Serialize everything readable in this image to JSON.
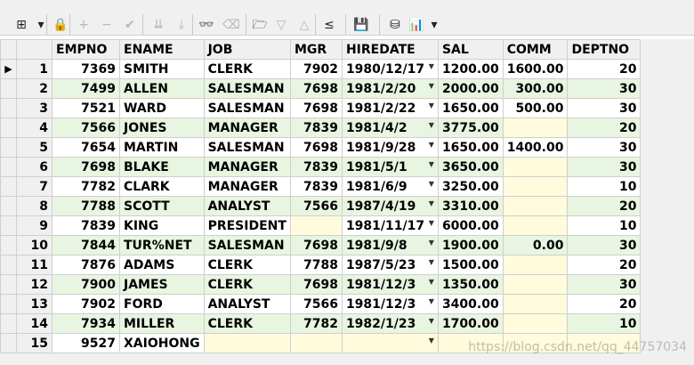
{
  "toolbar": {
    "buttons": [
      {
        "name": "grid-layout-icon",
        "glyph": "⊞",
        "disabled": false
      },
      {
        "name": "dropdown-arrow-icon",
        "glyph": "▾",
        "disabled": false
      },
      {
        "name": "lock-icon",
        "glyph": "🔒",
        "disabled": false
      },
      {
        "name": "insert-record-icon",
        "glyph": "+",
        "disabled": true
      },
      {
        "name": "delete-record-icon",
        "glyph": "−",
        "disabled": true
      },
      {
        "name": "post-changes-icon",
        "glyph": "✔",
        "disabled": true
      },
      {
        "name": "next-records-icon",
        "glyph": "⇊",
        "disabled": true
      },
      {
        "name": "last-records-icon",
        "glyph": "⤓",
        "disabled": true
      },
      {
        "name": "find-binoculars-icon",
        "glyph": "👓",
        "disabled": false
      },
      {
        "name": "clear-filter-icon",
        "glyph": "⌫",
        "disabled": true
      },
      {
        "name": "query-by-example-icon",
        "glyph": "🗁",
        "disabled": false
      },
      {
        "name": "filter-down-icon",
        "glyph": "▽",
        "disabled": true
      },
      {
        "name": "filter-up-icon",
        "glyph": "△",
        "disabled": true
      },
      {
        "name": "connect-icon",
        "glyph": "≤",
        "disabled": false
      },
      {
        "name": "save-icon",
        "glyph": "💾",
        "disabled": false
      },
      {
        "name": "export-icon",
        "glyph": "⛁",
        "disabled": false
      },
      {
        "name": "chart-icon",
        "glyph": "📊",
        "disabled": false
      },
      {
        "name": "chart-dropdown-icon",
        "glyph": "▾",
        "disabled": false
      }
    ]
  },
  "grid": {
    "columns": [
      "EMPNO",
      "ENAME",
      "JOB",
      "MGR",
      "HIREDATE",
      "SAL",
      "COMM",
      "DEPTNO"
    ],
    "current_row_indicator": "▶",
    "rows": [
      {
        "n": "1",
        "empno": "7369",
        "ename": "SMITH",
        "job": "CLERK",
        "mgr": "7902",
        "hiredate": "1980/12/17",
        "sal": "1200.00",
        "comm": "1600.00",
        "deptno": "20"
      },
      {
        "n": "2",
        "empno": "7499",
        "ename": "ALLEN",
        "job": "SALESMAN",
        "mgr": "7698",
        "hiredate": "1981/2/20",
        "sal": "2000.00",
        "comm": "300.00",
        "deptno": "30"
      },
      {
        "n": "3",
        "empno": "7521",
        "ename": "WARD",
        "job": "SALESMAN",
        "mgr": "7698",
        "hiredate": "1981/2/22",
        "sal": "1650.00",
        "comm": "500.00",
        "deptno": "30"
      },
      {
        "n": "4",
        "empno": "7566",
        "ename": "JONES",
        "job": "MANAGER",
        "mgr": "7839",
        "hiredate": "1981/4/2",
        "sal": "3775.00",
        "comm": "",
        "deptno": "20"
      },
      {
        "n": "5",
        "empno": "7654",
        "ename": "MARTIN",
        "job": "SALESMAN",
        "mgr": "7698",
        "hiredate": "1981/9/28",
        "sal": "1650.00",
        "comm": "1400.00",
        "deptno": "30"
      },
      {
        "n": "6",
        "empno": "7698",
        "ename": "BLAKE",
        "job": "MANAGER",
        "mgr": "7839",
        "hiredate": "1981/5/1",
        "sal": "3650.00",
        "comm": "",
        "deptno": "30"
      },
      {
        "n": "7",
        "empno": "7782",
        "ename": "CLARK",
        "job": "MANAGER",
        "mgr": "7839",
        "hiredate": "1981/6/9",
        "sal": "3250.00",
        "comm": "",
        "deptno": "10"
      },
      {
        "n": "8",
        "empno": "7788",
        "ename": "SCOTT",
        "job": "ANALYST",
        "mgr": "7566",
        "hiredate": "1987/4/19",
        "sal": "3310.00",
        "comm": "",
        "deptno": "20"
      },
      {
        "n": "9",
        "empno": "7839",
        "ename": "KING",
        "job": "PRESIDENT",
        "mgr": "",
        "hiredate": "1981/11/17",
        "sal": "6000.00",
        "comm": "",
        "deptno": "10"
      },
      {
        "n": "10",
        "empno": "7844",
        "ename": "TUR%NET",
        "job": "SALESMAN",
        "mgr": "7698",
        "hiredate": "1981/9/8",
        "sal": "1900.00",
        "comm": "0.00",
        "deptno": "30"
      },
      {
        "n": "11",
        "empno": "7876",
        "ename": "ADAMS",
        "job": "CLERK",
        "mgr": "7788",
        "hiredate": "1987/5/23",
        "sal": "1500.00",
        "comm": "",
        "deptno": "20"
      },
      {
        "n": "12",
        "empno": "7900",
        "ename": "JAMES",
        "job": "CLERK",
        "mgr": "7698",
        "hiredate": "1981/12/3",
        "sal": "1350.00",
        "comm": "",
        "deptno": "30"
      },
      {
        "n": "13",
        "empno": "7902",
        "ename": "FORD",
        "job": "ANALYST",
        "mgr": "7566",
        "hiredate": "1981/12/3",
        "sal": "3400.00",
        "comm": "",
        "deptno": "20"
      },
      {
        "n": "14",
        "empno": "7934",
        "ename": "MILLER",
        "job": "CLERK",
        "mgr": "7782",
        "hiredate": "1982/1/23",
        "sal": "1700.00",
        "comm": "",
        "deptno": "10"
      },
      {
        "n": "15",
        "empno": "9527",
        "ename": "XAIOHONG",
        "job": "",
        "mgr": "",
        "hiredate": "",
        "sal": "",
        "comm": "",
        "deptno": ""
      }
    ]
  },
  "watermark": "https://blog.csdn.net/qq_44757034",
  "colors": {
    "alt_row": "#e8f5e0",
    "null_cell": "#fffbdc",
    "header_bg": "#f0f0f0"
  }
}
